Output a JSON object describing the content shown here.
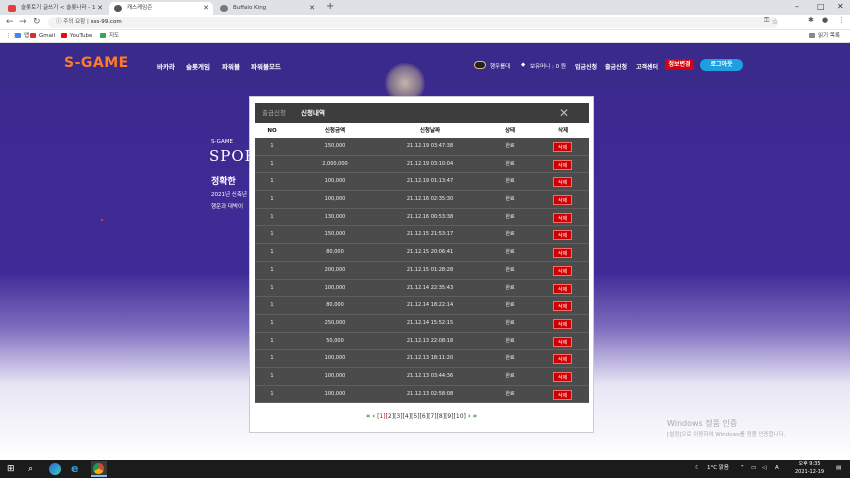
{
  "browser": {
    "tabs": [
      {
        "title": "슬롯토기 글쓰기 < 슬롯나라 - 1",
        "color": "#e04040"
      },
      {
        "title": "캐스케임즌",
        "color": "#555555"
      },
      {
        "title": "Buffalo King",
        "color": "#777777"
      }
    ],
    "address": {
      "insecure_label": "주의 요함",
      "url": "sss-99.com"
    },
    "bookmarks": [
      {
        "label": "앱",
        "color": "#4285f4"
      },
      {
        "label": "Gmail",
        "color": "#d93025"
      },
      {
        "label": "YouTube",
        "color": "#ff0000"
      },
      {
        "label": "지도",
        "color": "#34a853"
      }
    ],
    "reading_list": "읽기 목록"
  },
  "site": {
    "logo": "S-GAME",
    "menu": [
      "바카라",
      "슬롯게임",
      "파워볼",
      "파워볼모드"
    ],
    "header_info": {
      "nickname": "행우롤대",
      "balance": "보유머니 : 0 원"
    },
    "header_links": [
      "입금신청",
      "출금신청",
      "고객센터"
    ],
    "info_button": "정보변경",
    "logout_button": "로그아웃",
    "hero": {
      "kicker": "S-GAME",
      "title": "SPOR",
      "headline": "정확한 ",
      "line1": "2021년 신축년",
      "line2": "행운과 대박이"
    }
  },
  "modal": {
    "tabs": [
      "출금신청",
      "신청내역"
    ],
    "columns": [
      "NO",
      "신청금액",
      "신청날짜",
      "상태",
      "삭제"
    ],
    "rows": [
      {
        "no": "1",
        "amount": "150,000",
        "date": "21.12.19 03:47:38",
        "status": "완료",
        "action": "삭제"
      },
      {
        "no": "1",
        "amount": "2,000,000",
        "date": "21.12.19 03:10:04",
        "status": "완료",
        "action": "삭제"
      },
      {
        "no": "1",
        "amount": "100,000",
        "date": "21.12.19 01:13:47",
        "status": "완료",
        "action": "삭제"
      },
      {
        "no": "1",
        "amount": "100,000",
        "date": "21.12.16 02:35:30",
        "status": "완료",
        "action": "삭제"
      },
      {
        "no": "1",
        "amount": "130,000",
        "date": "21.12.16 00:53:38",
        "status": "완료",
        "action": "삭제"
      },
      {
        "no": "1",
        "amount": "150,000",
        "date": "21.12.15 21:53:17",
        "status": "완료",
        "action": "삭제"
      },
      {
        "no": "1",
        "amount": "80,000",
        "date": "21.12.15 20:06:41",
        "status": "완료",
        "action": "삭제"
      },
      {
        "no": "1",
        "amount": "200,000",
        "date": "21.12.15 01:28:28",
        "status": "완료",
        "action": "삭제"
      },
      {
        "no": "1",
        "amount": "100,000",
        "date": "21.12.14 22:35:43",
        "status": "완료",
        "action": "삭제"
      },
      {
        "no": "1",
        "amount": "80,000",
        "date": "21.12.14 18:22:14",
        "status": "완료",
        "action": "삭제"
      },
      {
        "no": "1",
        "amount": "250,000",
        "date": "21.12.14 15:52:15",
        "status": "완료",
        "action": "삭제"
      },
      {
        "no": "1",
        "amount": "50,000",
        "date": "21.12.13 22:08:18",
        "status": "완료",
        "action": "삭제"
      },
      {
        "no": "1",
        "amount": "100,000",
        "date": "21.12.13 18:11:20",
        "status": "완료",
        "action": "삭제"
      },
      {
        "no": "1",
        "amount": "100,000",
        "date": "21.12.13 03:44:36",
        "status": "완료",
        "action": "삭제"
      },
      {
        "no": "1",
        "amount": "100,000",
        "date": "21.12.13 02:58:08",
        "status": "완료",
        "action": "삭제"
      }
    ],
    "pagination": {
      "pages": [
        "[1]",
        "[2]",
        "[3]",
        "[4]",
        "[5]",
        "[6]",
        "[7]",
        "[8]",
        "[9]",
        "[10]"
      ],
      "current": 1
    }
  },
  "watermark": {
    "title": "Windows 정품 인증",
    "subtitle": "[설정]으로 이동하여 Windows를 정품 인증합니다."
  },
  "taskbar": {
    "weather": "1°C 맑음",
    "time": "오후 9:35",
    "date": "2021-12-19"
  }
}
